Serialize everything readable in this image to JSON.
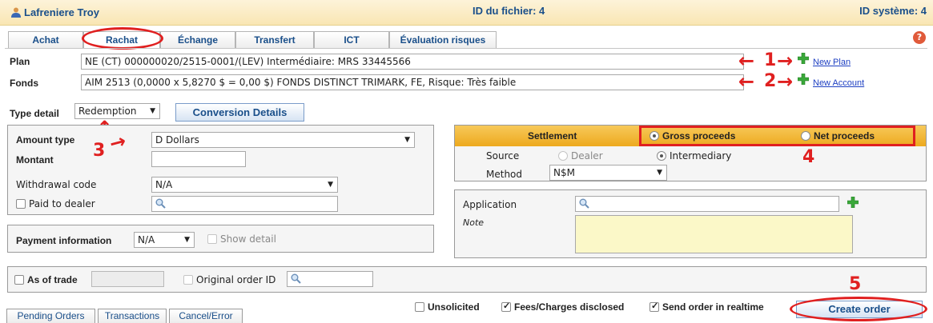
{
  "header": {
    "user_name": "Lafreniere Troy",
    "file_id": "ID du fichier: 4",
    "system_id": "ID système: 4"
  },
  "tabs": [
    {
      "label": "Achat"
    },
    {
      "label": "Rachat"
    },
    {
      "label": "Échange"
    },
    {
      "label": "Transfert"
    },
    {
      "label": "ICT"
    },
    {
      "label": "Évaluation risques"
    }
  ],
  "help_label": "?",
  "plan": {
    "label": "Plan",
    "value": "NE (CT) 000000020/2515-0001/(LEV) Intermédiaire: MRS 33445566",
    "link": "New Plan"
  },
  "fonds": {
    "label": "Fonds",
    "value": "AIM 2513 (0,0000 x 5,8270 $ = 0,00 $) FONDS DISTINCT TRIMARK, FE, Risque: Très faible",
    "link": "New Account"
  },
  "type_detail": {
    "label": "Type detail",
    "value": "Redemption",
    "conversion_button": "Conversion Details"
  },
  "amount": {
    "amount_type_label": "Amount type",
    "amount_type_value": "D Dollars",
    "montant_label": "Montant",
    "montant_value": "",
    "withdrawal_label": "Withdrawal code",
    "withdrawal_value": "N/A",
    "paid_to_dealer_label": "Paid to dealer"
  },
  "payment": {
    "label": "Payment information",
    "value": "N/A",
    "show_detail_label": "Show detail"
  },
  "settlement": {
    "title": "Settlement",
    "gross_label": "Gross proceeds",
    "net_label": "Net proceeds",
    "source_label": "Source",
    "dealer_label": "Dealer",
    "intermediary_label": "Intermediary",
    "method_label": "Method",
    "method_value": "N$M"
  },
  "application": {
    "label": "Application",
    "note_label": "Note"
  },
  "trade": {
    "as_of_trade_label": "As of trade",
    "original_order_label": "Original order ID"
  },
  "footer": {
    "unsolicited_label": "Unsolicited",
    "fees_label": "Fees/Charges disclosed",
    "realtime_label": "Send order in realtime",
    "create_button": "Create order"
  },
  "bottom_tabs": [
    {
      "label": "Pending Orders"
    },
    {
      "label": "Transactions"
    },
    {
      "label": "Cancel/Error"
    }
  ],
  "annotations": {
    "n1": "1",
    "n2": "2",
    "n3": "3",
    "n4": "4",
    "n5": "5"
  },
  "colors": {
    "accent": "#1a4f8a",
    "annotation_red": "#e02020",
    "settlement_header": "#f2b632",
    "note_bg": "#fbf8c8"
  }
}
